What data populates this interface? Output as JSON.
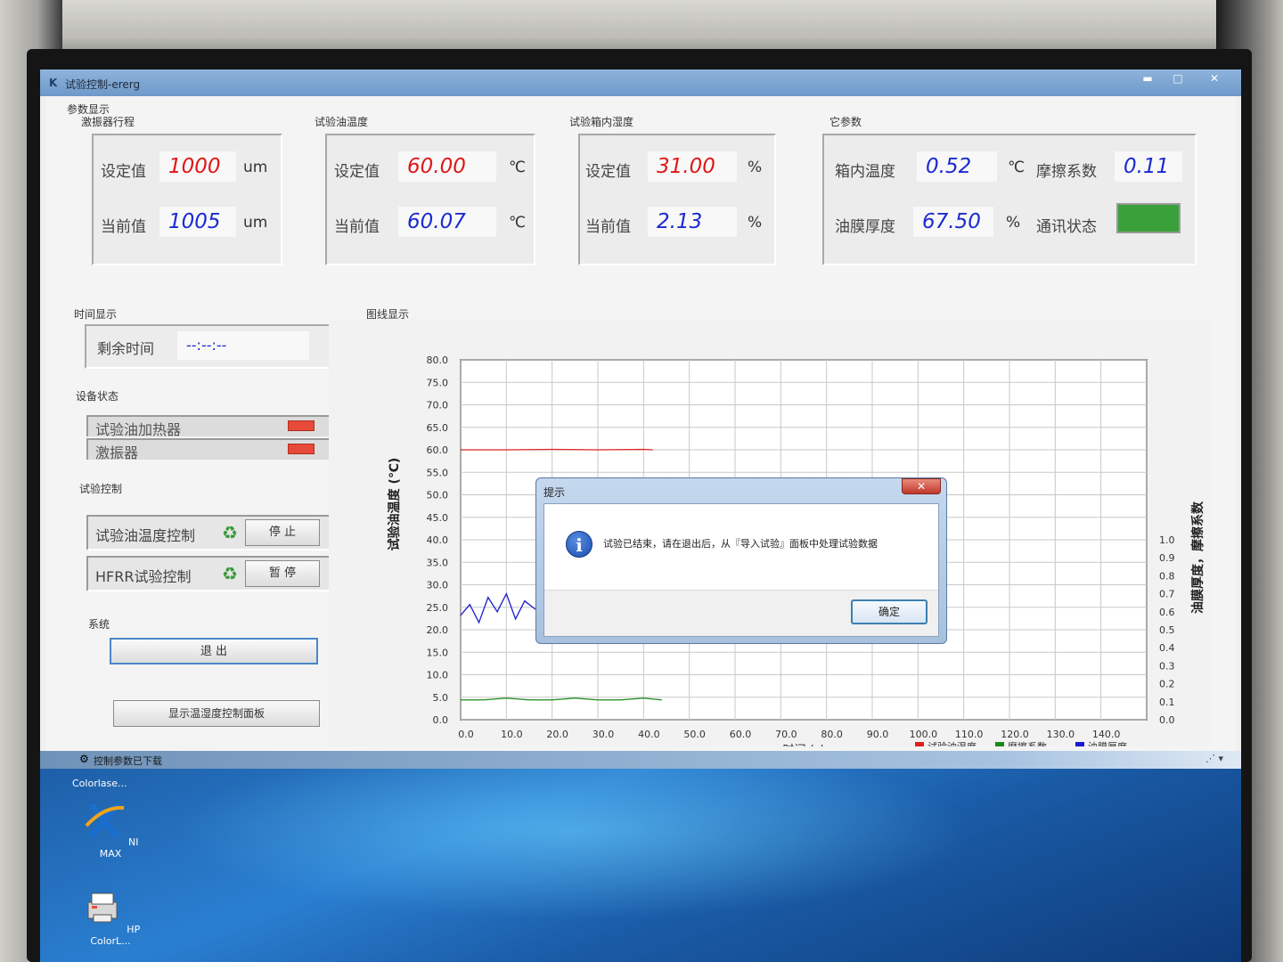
{
  "window": {
    "title": "试验控制-ererg"
  },
  "params_section": {
    "label": "参数显示"
  },
  "vibrator_travel": {
    "title": "激振器行程",
    "set_label": "设定值",
    "set_value": "1000",
    "set_unit": "um",
    "cur_label": "当前值",
    "cur_value": "1005",
    "cur_unit": "um"
  },
  "oil_temp": {
    "title": "试验油温度",
    "set_label": "设定值",
    "set_value": "60.00",
    "set_unit": "℃",
    "cur_label": "当前值",
    "cur_value": "60.07",
    "cur_unit": "℃"
  },
  "box_humidity": {
    "title": "试验箱内湿度",
    "set_label": "设定值",
    "set_value": "31.00",
    "set_unit": "%",
    "cur_label": "当前值",
    "cur_value": "2.13",
    "cur_unit": "%"
  },
  "other_params": {
    "title": "它参数",
    "box_temp_label": "箱内温度",
    "box_temp_value": "0.52",
    "box_temp_unit": "℃",
    "friction_label": "摩擦系数",
    "friction_value": "0.11",
    "film_label": "油膜厚度",
    "film_value": "67.50",
    "film_unit": "%",
    "comm_label": "通讯状态",
    "comm_color": "#3aa13a"
  },
  "time_display": {
    "title": "时间显示",
    "remaining_label": "剩余时间",
    "remaining_value": "--:--:--"
  },
  "device_status": {
    "title": "设备状态",
    "items": [
      {
        "label": "试验油加热器",
        "color": "#e84a3a"
      },
      {
        "label": "激振器",
        "color": "#e84a3a"
      }
    ]
  },
  "test_control": {
    "title": "试验控制",
    "rows": [
      {
        "label": "试验油温度控制",
        "button": "停 止"
      },
      {
        "label": "HFRR试验控制",
        "button": "暂 停"
      }
    ]
  },
  "system": {
    "title": "系统",
    "exit_button": "退 出",
    "panel_button": "显示温湿度控制面板"
  },
  "chart_section": {
    "title": "图线显示"
  },
  "chart_data": {
    "type": "line",
    "title": "",
    "xlabel": "时间 (s)",
    "ylabel": "试验油温度 (℃)",
    "y2label": "油膜厚度，摩擦系数",
    "xlim": [
      0,
      150
    ],
    "ylim": [
      0,
      80
    ],
    "y2lim": [
      0,
      1
    ],
    "x_ticks": [
      "0.0",
      "10.0",
      "20.0",
      "30.0",
      "40.0",
      "50.0",
      "60.0",
      "70.0",
      "80.0",
      "90.0",
      "100.0",
      "110.0",
      "120.0",
      "130.0",
      "140.0"
    ],
    "y_ticks": [
      "0.0",
      "5.0",
      "10.0",
      "15.0",
      "20.0",
      "25.0",
      "30.0",
      "35.0",
      "40.0",
      "45.0",
      "50.0",
      "55.0",
      "60.0",
      "65.0",
      "70.0",
      "75.0",
      "80.0"
    ],
    "y2_ticks": [
      "0.0",
      "0.1",
      "0.2",
      "0.3",
      "0.4",
      "0.5",
      "0.6",
      "0.7",
      "0.8",
      "0.9",
      "1.0"
    ],
    "grid": true,
    "legend_position": "bottom-right",
    "series": [
      {
        "name": "试验油温度",
        "color": "#e02020",
        "axis": "left",
        "x": [
          0,
          10,
          20,
          30,
          40,
          42
        ],
        "y": [
          60.0,
          60.0,
          60.1,
          60.0,
          60.1,
          60.0
        ]
      },
      {
        "name": "摩擦系数",
        "color": "#1a8a1a",
        "axis": "right",
        "x": [
          0,
          5,
          10,
          15,
          20,
          25,
          30,
          35,
          40,
          44
        ],
        "y": [
          0.11,
          0.11,
          0.12,
          0.11,
          0.11,
          0.12,
          0.11,
          0.11,
          0.12,
          0.11
        ]
      },
      {
        "name": "油膜厚度",
        "color": "#1a1ad0",
        "axis": "right",
        "x": [
          0,
          2,
          4,
          6,
          8,
          10,
          12,
          14,
          16,
          18
        ],
        "y": [
          0.58,
          0.64,
          0.54,
          0.68,
          0.6,
          0.7,
          0.56,
          0.66,
          0.62,
          0.59
        ]
      }
    ]
  },
  "statusbar": {
    "text": "控制参数已下载"
  },
  "dialog": {
    "title": "提示",
    "message": "试验已结束，请在退出后，从『导入试验』面板中处理试验数据",
    "ok_button": "确定"
  },
  "desktop": {
    "top_label": "Colorlase...",
    "icons": [
      {
        "label": "NI MAX"
      },
      {
        "label": "HP ColorL..."
      }
    ]
  }
}
